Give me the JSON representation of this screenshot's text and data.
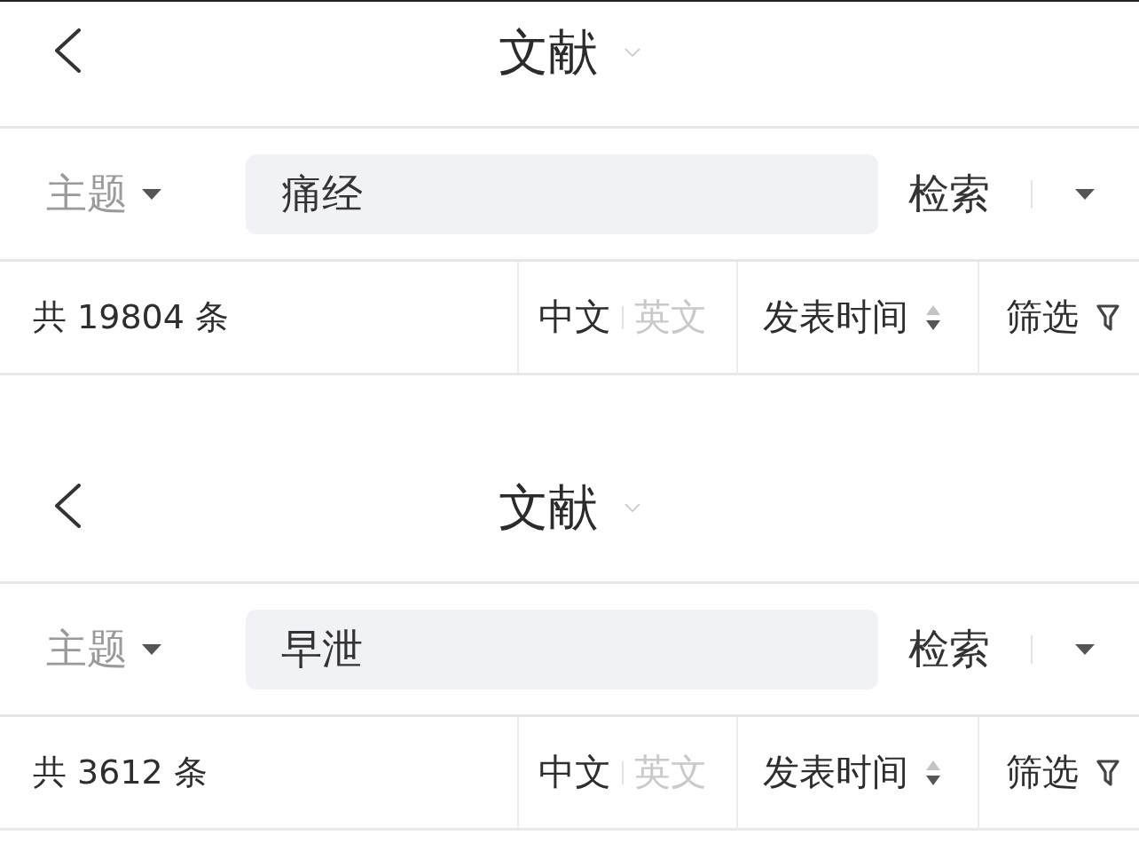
{
  "panels": [
    {
      "header": {
        "title": "文献"
      },
      "search": {
        "field_selector": "主题",
        "query": "痛经",
        "button": "检索"
      },
      "results": {
        "count": "共 19804 条",
        "languages": [
          {
            "label": "中文",
            "selected": true
          },
          {
            "label": "英文",
            "selected": false
          }
        ],
        "sort": {
          "label": "发表时间",
          "descending": true
        },
        "filter": {
          "label": "筛选"
        }
      }
    },
    {
      "header": {
        "title": "文献"
      },
      "search": {
        "field_selector": "主题",
        "query": "早泄",
        "button": "检索"
      },
      "results": {
        "count": "共 3612 条",
        "languages": [
          {
            "label": "中文",
            "selected": true
          },
          {
            "label": "英文",
            "selected": false
          }
        ],
        "sort": {
          "label": "发表时间",
          "descending": true
        },
        "filter": {
          "label": "筛选"
        }
      }
    }
  ]
}
